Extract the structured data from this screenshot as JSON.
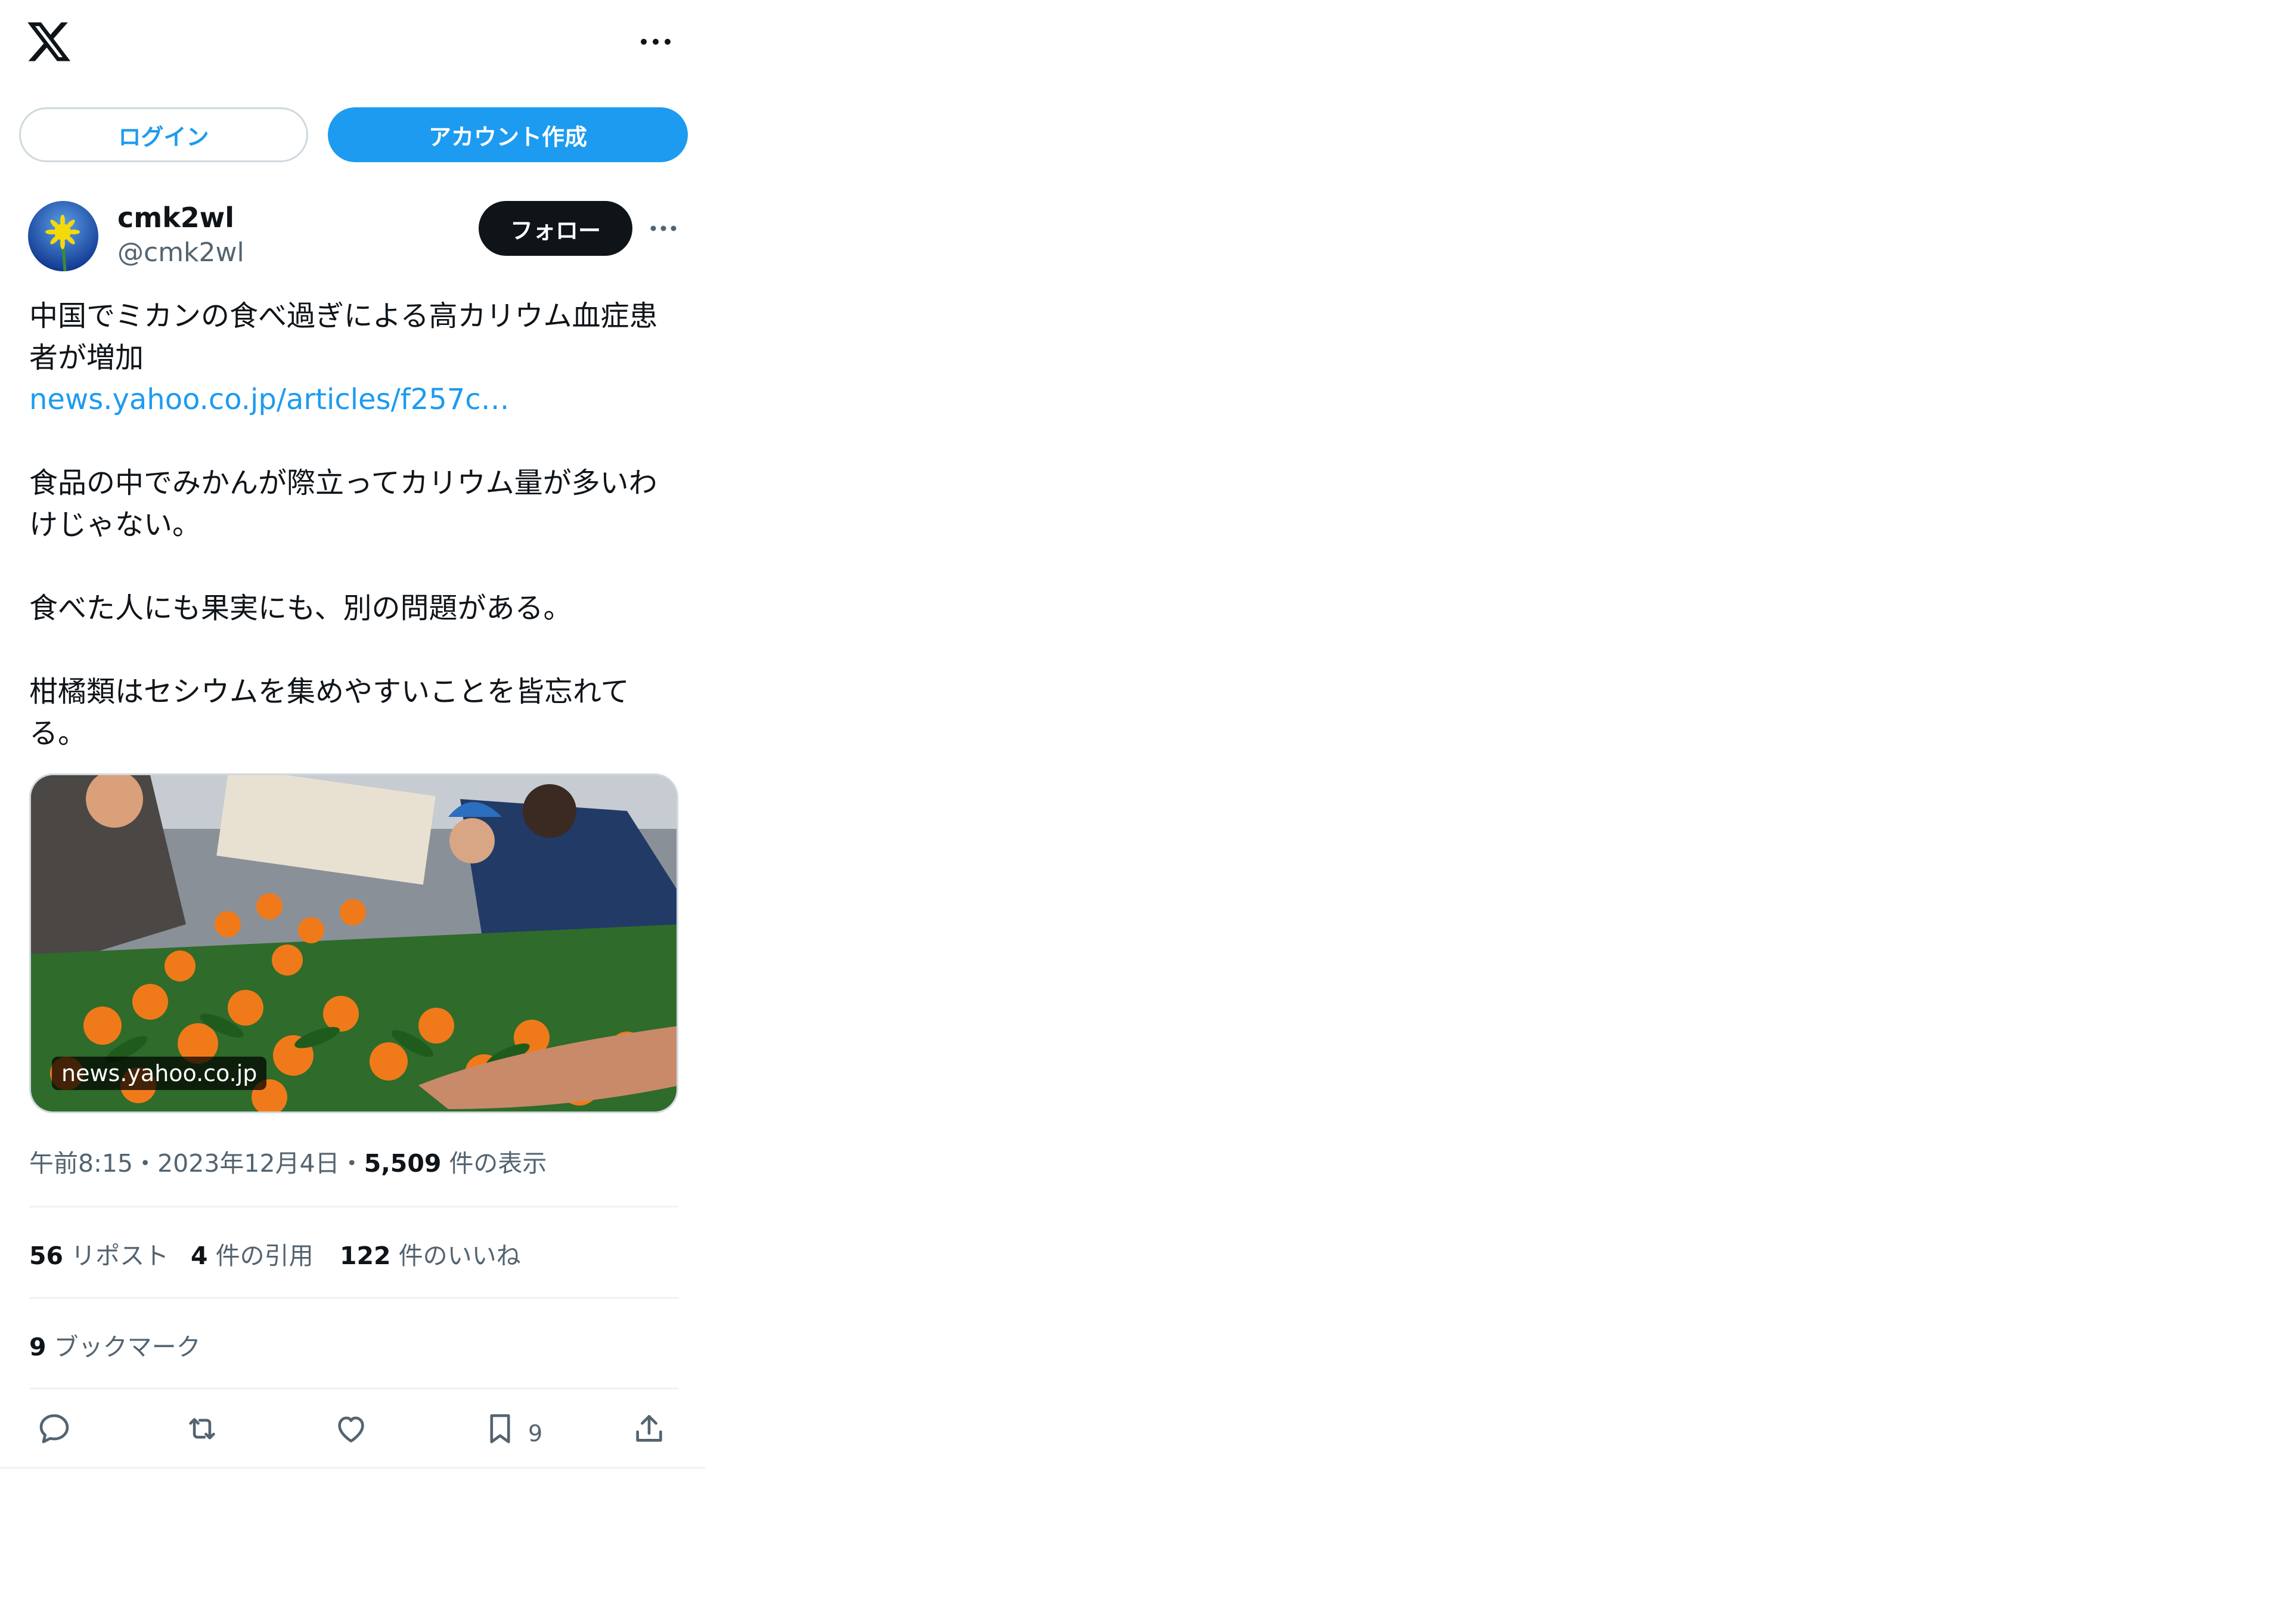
{
  "header": {
    "logo_icon": "x-logo-icon",
    "more_icon": "more-horizontal-icon",
    "login_label": "ログイン",
    "signup_label": "アカウント作成"
  },
  "tweet": {
    "author": {
      "name": "cmk2wl",
      "handle": "@cmk2wl",
      "avatar_icon": "dandelion-avatar"
    },
    "follow_label": "フォロー",
    "lines": [
      "中国でミカンの食べ過ぎによる高カリウム血症患",
      "者が増加",
      "news.yahoo.co.jp/articles/f257c…",
      "食品の中でみかんが際立ってカリウム量が多いわ",
      "けじゃない。",
      "食べた人にも果実にも、別の問題がある。",
      "柑橘類はセシウムを集めやすいことを皆忘れて",
      "る。"
    ],
    "media": {
      "domain": "news.yahoo.co.jp"
    },
    "meta": {
      "time": "午前8:15",
      "sep1": "・",
      "date": "2023年12月4日",
      "sep2": "・",
      "views": "5,509",
      "views_label": " 件の表示"
    },
    "stats": {
      "reposts": "56",
      "reposts_label": " リポスト",
      "quotes": "4",
      "quotes_label": " 件の引用",
      "likes": "122",
      "likes_label": " 件のいいね",
      "bookmarks": "9",
      "bookmarks_label": " ブックマーク"
    },
    "actions": {
      "bookmark_count": "9"
    }
  },
  "colors": {
    "accent": "#1d9bf0",
    "text": "#0f1419",
    "secondary": "#536471",
    "divider": "#eff3f4"
  }
}
